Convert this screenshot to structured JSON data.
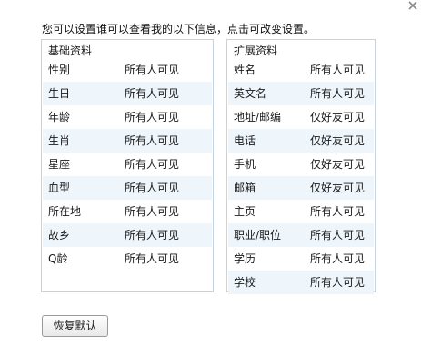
{
  "intro_text": "您可以设置谁可以查看我的以下信息，点击可改变设置。",
  "basic": {
    "title": "基础资料",
    "rows": [
      {
        "label": "性别",
        "value": "所有人可见"
      },
      {
        "label": "生日",
        "value": "所有人可见"
      },
      {
        "label": "年龄",
        "value": "所有人可见"
      },
      {
        "label": "生肖",
        "value": "所有人可见"
      },
      {
        "label": "星座",
        "value": "所有人可见"
      },
      {
        "label": "血型",
        "value": "所有人可见"
      },
      {
        "label": "所在地",
        "value": "所有人可见"
      },
      {
        "label": "故乡",
        "value": "所有人可见"
      },
      {
        "label": "Q龄",
        "value": "所有人可见"
      }
    ]
  },
  "extended": {
    "title": "扩展资料",
    "rows": [
      {
        "label": "姓名",
        "value": "所有人可见"
      },
      {
        "label": "英文名",
        "value": "所有人可见"
      },
      {
        "label": "地址/邮编",
        "value": "仅好友可见"
      },
      {
        "label": "电话",
        "value": "仅好友可见"
      },
      {
        "label": "手机",
        "value": "仅好友可见"
      },
      {
        "label": "邮箱",
        "value": "仅好友可见"
      },
      {
        "label": "主页",
        "value": "所有人可见"
      },
      {
        "label": "职业/职位",
        "value": "所有人可见"
      },
      {
        "label": "学历",
        "value": "所有人可见"
      },
      {
        "label": "学校",
        "value": "所有人可见"
      }
    ]
  },
  "reset_label": "恢复默认",
  "colors": {
    "panel_border": "#c7d3e0",
    "row_alt": "#eef6fc"
  },
  "icons": {
    "close": "close-icon"
  }
}
